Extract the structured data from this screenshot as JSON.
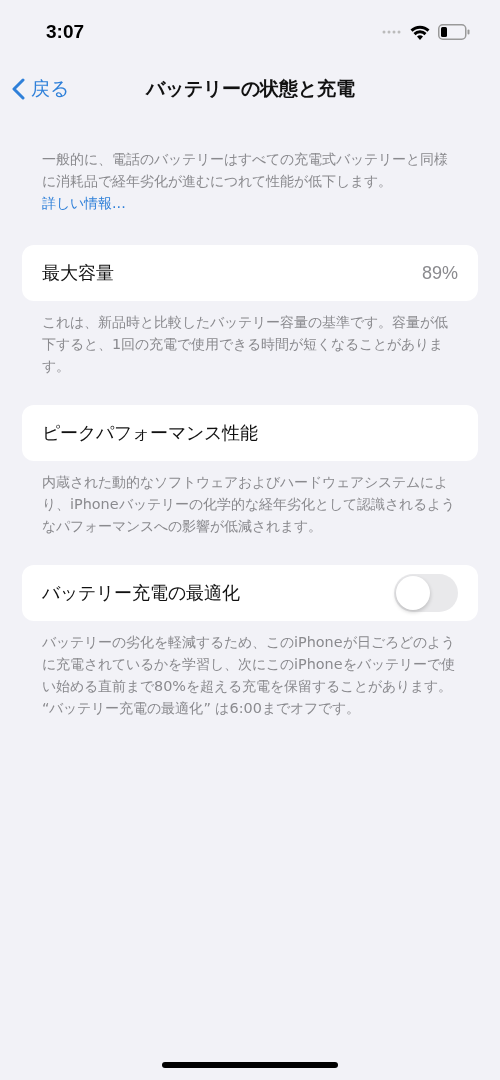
{
  "status_bar": {
    "time": "3:07"
  },
  "nav": {
    "back": "戻る",
    "title": "バッテリーの状態と充電"
  },
  "intro": {
    "text": "一般的に、電話のバッテリーはすべての充電式バッテリーと同様に消耗品で経年劣化が進むにつれて性能が低下します。",
    "link": "詳しい情報..."
  },
  "sections": [
    {
      "kind": "value",
      "label": "最大容量",
      "value": "89%",
      "footer": "これは、新品時と比較したバッテリー容量の基準です。容量が低下すると、1回の充電で使用できる時間が短くなることがあります。"
    },
    {
      "kind": "plain",
      "label": "ピークパフォーマンス性能",
      "footer": "内蔵された動的なソフトウェアおよびハードウェアシステムにより、iPhoneバッテリーの化学的な経年劣化として認識されるようなパフォーマンスへの影響が低減されます。"
    },
    {
      "kind": "toggle",
      "label": "バッテリー充電の最適化",
      "on": false,
      "footer": "バッテリーの劣化を軽減するため、このiPhoneが日ごろどのように充電されているかを学習し、次にこのiPhoneをバッテリーで使い始める直前まで80%を超える充電を保留することがあります。 “バッテリー充電の最適化” は6:00までオフです。"
    }
  ]
}
